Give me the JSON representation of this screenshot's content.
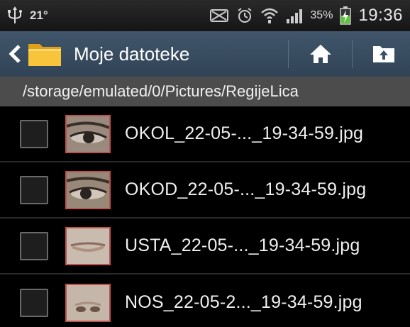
{
  "status_bar": {
    "temperature": "21°",
    "battery_percent": "35%",
    "time": "19:36",
    "icons": [
      "usb-icon",
      "no-signal-icon",
      "alarm-icon",
      "wifi-icon",
      "signal-icon",
      "battery-charging-icon"
    ]
  },
  "action_bar": {
    "title": "Moje datoteke",
    "icons": [
      "back-chevron-icon",
      "folder-icon",
      "home-icon",
      "up-folder-icon"
    ],
    "accent": "#3a4f63"
  },
  "path_bar": {
    "path": "/storage/emulated/0/Pictures/RegijeLica"
  },
  "files": [
    {
      "name": "OKOL_22-05-..._19-34-59.jpg",
      "thumbnail": "eye"
    },
    {
      "name": "OKOD_22-05-..._19-34-59.jpg",
      "thumbnail": "eye"
    },
    {
      "name": "USTA_22-05-..._19-34-59.jpg",
      "thumbnail": "mouth"
    },
    {
      "name": "NOS_22-05-2..._19-34-59.jpg",
      "thumbnail": "nose"
    }
  ],
  "colors": {
    "thumbnail_border": "#c0504d",
    "path_bar_bg": "#4c4c4c",
    "battery_green": "#5cc53c"
  }
}
